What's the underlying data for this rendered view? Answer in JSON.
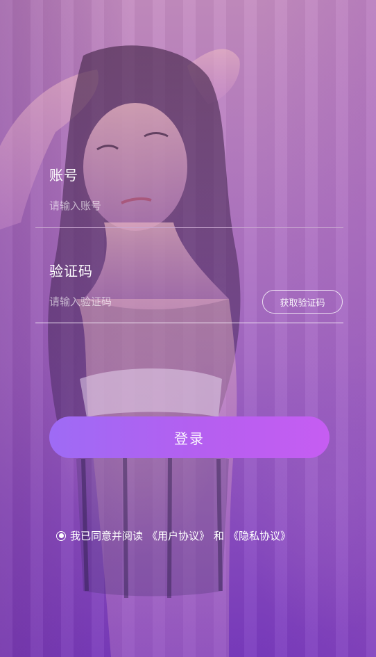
{
  "login_form": {
    "account": {
      "label": "账号",
      "placeholder": "请输入账号",
      "value": ""
    },
    "code": {
      "label": "验证码",
      "placeholder": "请输入验证码",
      "value": "",
      "get_code_label": "获取验证码"
    },
    "login_label": "登录"
  },
  "agreement": {
    "checked": true,
    "prefix": "我已同意并阅读",
    "user_agreement_label": "《用户协议》",
    "conjunction": "和",
    "privacy_policy_label": "《隐私协议》"
  },
  "colors": {
    "button_gradient_start": "#9e6bf5",
    "button_gradient_end": "#c65df2",
    "underline_account": "#c8a6cf",
    "underline_code": "#f2e8f5"
  }
}
